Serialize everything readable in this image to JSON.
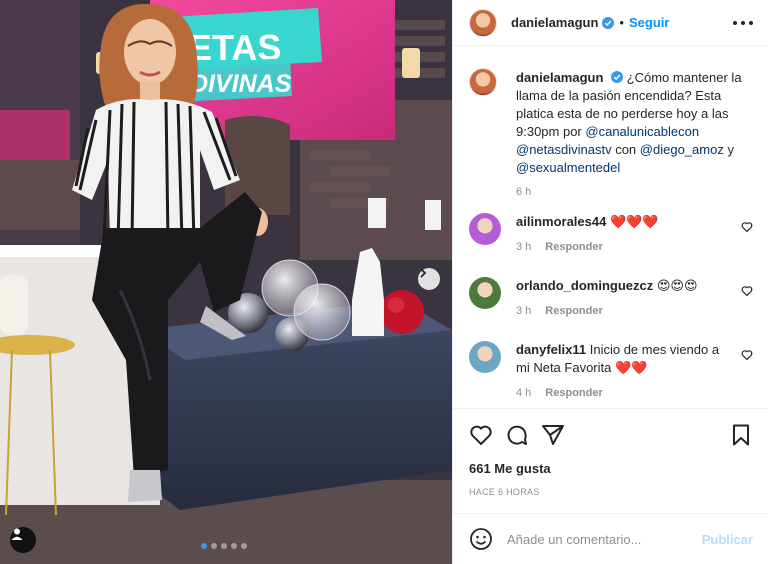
{
  "post": {
    "author": {
      "username": "danielamagun",
      "verified": true,
      "follow_label": "Seguir",
      "separator": "•"
    },
    "media": {
      "sign_line1": "NETAS",
      "sign_line2": "DIVINAS",
      "slide_count": 5,
      "active_slide": 1
    },
    "caption": {
      "username": "danielamagun",
      "text_intro": "¿Cómo mantener la llama de la pasión encendida? Esta platica esta de no perderse hoy a las 9:30pm por",
      "mention1": "@canalunicablecon",
      "mention2": "@netasdivinastv",
      "conj_con": "con",
      "mention3": "@diego_amoz",
      "conj_y": "y",
      "mention4": "@sexualmentedel",
      "time": "6 h"
    },
    "comments": [
      {
        "username": "ailinmorales44",
        "text": "❤️❤️❤️",
        "time": "3 h",
        "reply_label": "Responder",
        "avatar_color": "#b65bd8"
      },
      {
        "username": "orlando_dominguezcz",
        "text": "😍😍😍",
        "time": "3 h",
        "reply_label": "Responder",
        "avatar_color": "#4d7a3b"
      },
      {
        "username": "danyfelix11",
        "text": "Inicio de mes viendo a mi Neta Favorita ❤️❤️",
        "time": "4 h",
        "reply_label": "Responder",
        "avatar_color": "#6aa7c4"
      }
    ],
    "likes": "661 Me gusta",
    "time_ago": "HACE 6 HORAS",
    "comment_input": {
      "placeholder": "Añade un comentario...",
      "publish_label": "Publicar"
    },
    "colors": {
      "accent": "#0095f6",
      "publish_disabled": "#b2dffc",
      "text_secondary": "#8e8e8e",
      "heart_red": "#ed4956"
    }
  }
}
